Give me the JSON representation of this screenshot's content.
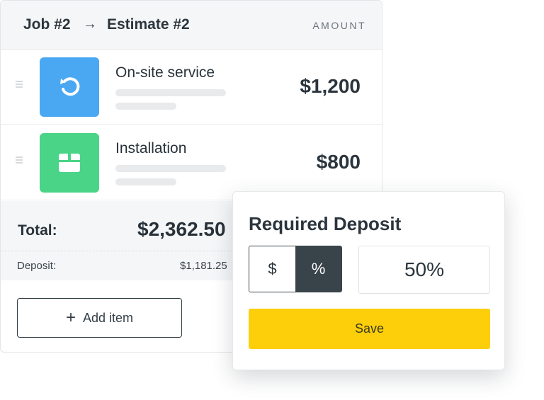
{
  "header": {
    "job": "Job #2",
    "arrow": "→",
    "estimate": "Estimate #2",
    "amount_label": "AMOUNT"
  },
  "items": [
    {
      "title": "On-site service",
      "price": "$1,200",
      "icon": "refresh-icon",
      "color": "#4aa8f2"
    },
    {
      "title": "Installation",
      "price": "$800",
      "icon": "box-icon",
      "color": "#49d487"
    }
  ],
  "totals": {
    "total_label": "Total:",
    "total_value": "$2,362.50",
    "deposit_label": "Deposit:",
    "deposit_value": "$1,181.25"
  },
  "add_item": {
    "icon": "plus-icon",
    "label": "Add item"
  },
  "deposit_popup": {
    "title": "Required Deposit",
    "dollar_label": "$",
    "percent_label": "%",
    "selected_mode": "%",
    "value": "50%",
    "save_label": "Save"
  },
  "colors": {
    "accent_yellow": "#fccf0a",
    "dark_toggle": "#39434a",
    "blue_tile": "#4aa8f2",
    "green_tile": "#49d487"
  }
}
